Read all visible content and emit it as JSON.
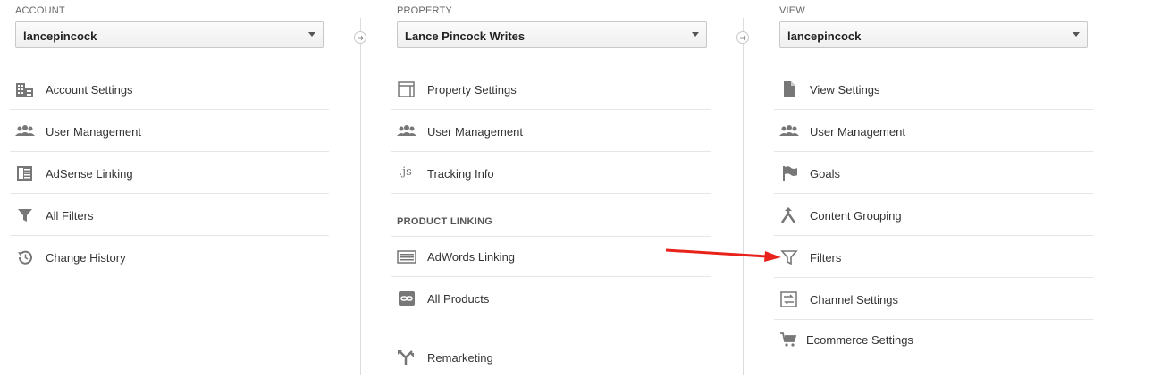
{
  "colors": {
    "icon": "#777777",
    "divider": "#dcdcdc",
    "arrow": "#e8221b"
  },
  "account": {
    "header": "ACCOUNT",
    "selected": "lancepincock",
    "items": [
      {
        "label": "Account Settings",
        "icon": "building-icon"
      },
      {
        "label": "User Management",
        "icon": "users-icon"
      },
      {
        "label": "AdSense Linking",
        "icon": "adsense-icon"
      },
      {
        "label": "All Filters",
        "icon": "filter-icon"
      },
      {
        "label": "Change History",
        "icon": "history-icon"
      }
    ]
  },
  "property": {
    "header": "PROPERTY",
    "selected": "Lance Pincock Writes",
    "items": [
      {
        "label": "Property Settings",
        "icon": "layout-icon"
      },
      {
        "label": "User Management",
        "icon": "users-icon"
      },
      {
        "label": "Tracking Info",
        "icon": "js-icon",
        "glyph": ".js"
      }
    ],
    "section_label": "PRODUCT LINKING",
    "linking_items": [
      {
        "label": "AdWords Linking",
        "icon": "adwords-icon"
      },
      {
        "label": "All Products",
        "icon": "link-icon"
      },
      {
        "label": "Remarketing",
        "icon": "remarketing-icon"
      }
    ]
  },
  "view": {
    "header": "VIEW",
    "selected": "lancepincock",
    "items": [
      {
        "label": "View Settings",
        "icon": "document-icon"
      },
      {
        "label": "User Management",
        "icon": "users-icon"
      },
      {
        "label": "Goals",
        "icon": "flag-icon"
      },
      {
        "label": "Content Grouping",
        "icon": "grouping-icon"
      },
      {
        "label": "Filters",
        "icon": "filter-icon"
      },
      {
        "label": "Channel Settings",
        "icon": "channel-icon"
      },
      {
        "label": "Ecommerce Settings",
        "icon": "cart-icon"
      }
    ]
  }
}
